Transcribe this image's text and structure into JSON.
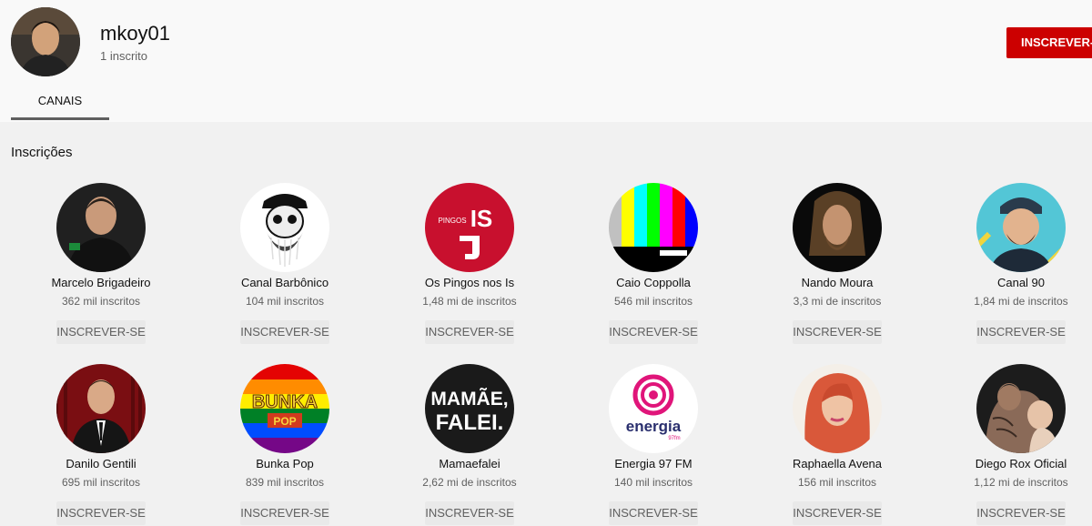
{
  "owner": {
    "name": "mkoy01",
    "subscribers": "1 inscrito",
    "subscribe_label": "INSCREVER-SE"
  },
  "tabs": [
    {
      "label": "CANAIS",
      "active": true
    }
  ],
  "section": {
    "title": "Inscrições"
  },
  "channels": [
    {
      "name": "Marcelo Brigadeiro",
      "subscribers": "362 mil inscritos",
      "button": "INSCREVER-SE"
    },
    {
      "name": "Canal Barbônico",
      "subscribers": "104 mil inscritos",
      "button": "INSCREVER-SE"
    },
    {
      "name": "Os Pingos nos Is",
      "subscribers": "1,48 mi de inscritos",
      "button": "INSCREVER-SE",
      "logo_text": [
        "PINGOS",
        "IS"
      ]
    },
    {
      "name": "Caio Coppolla",
      "subscribers": "546 mil inscritos",
      "button": "INSCREVER-SE"
    },
    {
      "name": "Nando Moura",
      "subscribers": "3,3 mi de inscritos",
      "button": "INSCREVER-SE"
    },
    {
      "name": "Canal 90",
      "subscribers": "1,84 mi de inscritos",
      "button": "INSCREVER-SE"
    },
    {
      "name": "Danilo Gentili",
      "subscribers": "695 mil inscritos",
      "button": "INSCREVER-SE"
    },
    {
      "name": "Bunka Pop",
      "subscribers": "839 mil inscritos",
      "button": "INSCREVER-SE",
      "logo_text": [
        "BUNKA",
        "POP"
      ]
    },
    {
      "name": "Mamaefalei",
      "subscribers": "2,62 mi de inscritos",
      "button": "INSCREVER-SE",
      "logo_text": [
        "MAMÃE,",
        "FALEI."
      ]
    },
    {
      "name": "Energia 97 FM",
      "subscribers": "140 mil inscritos",
      "button": "INSCREVER-SE",
      "logo_text": [
        "energia",
        "97fm"
      ]
    },
    {
      "name": "Raphaella Avena",
      "subscribers": "156 mil inscritos",
      "button": "INSCREVER-SE"
    },
    {
      "name": "Diego Rox Oficial",
      "subscribers": "1,12 mi de inscritos",
      "button": "INSCREVER-SE"
    }
  ],
  "colors": {
    "subscribe_red": "#cc0000",
    "page_bg": "#f1f1f1",
    "header_bg": "#f9f9f9",
    "secondary_text": "#606060"
  }
}
